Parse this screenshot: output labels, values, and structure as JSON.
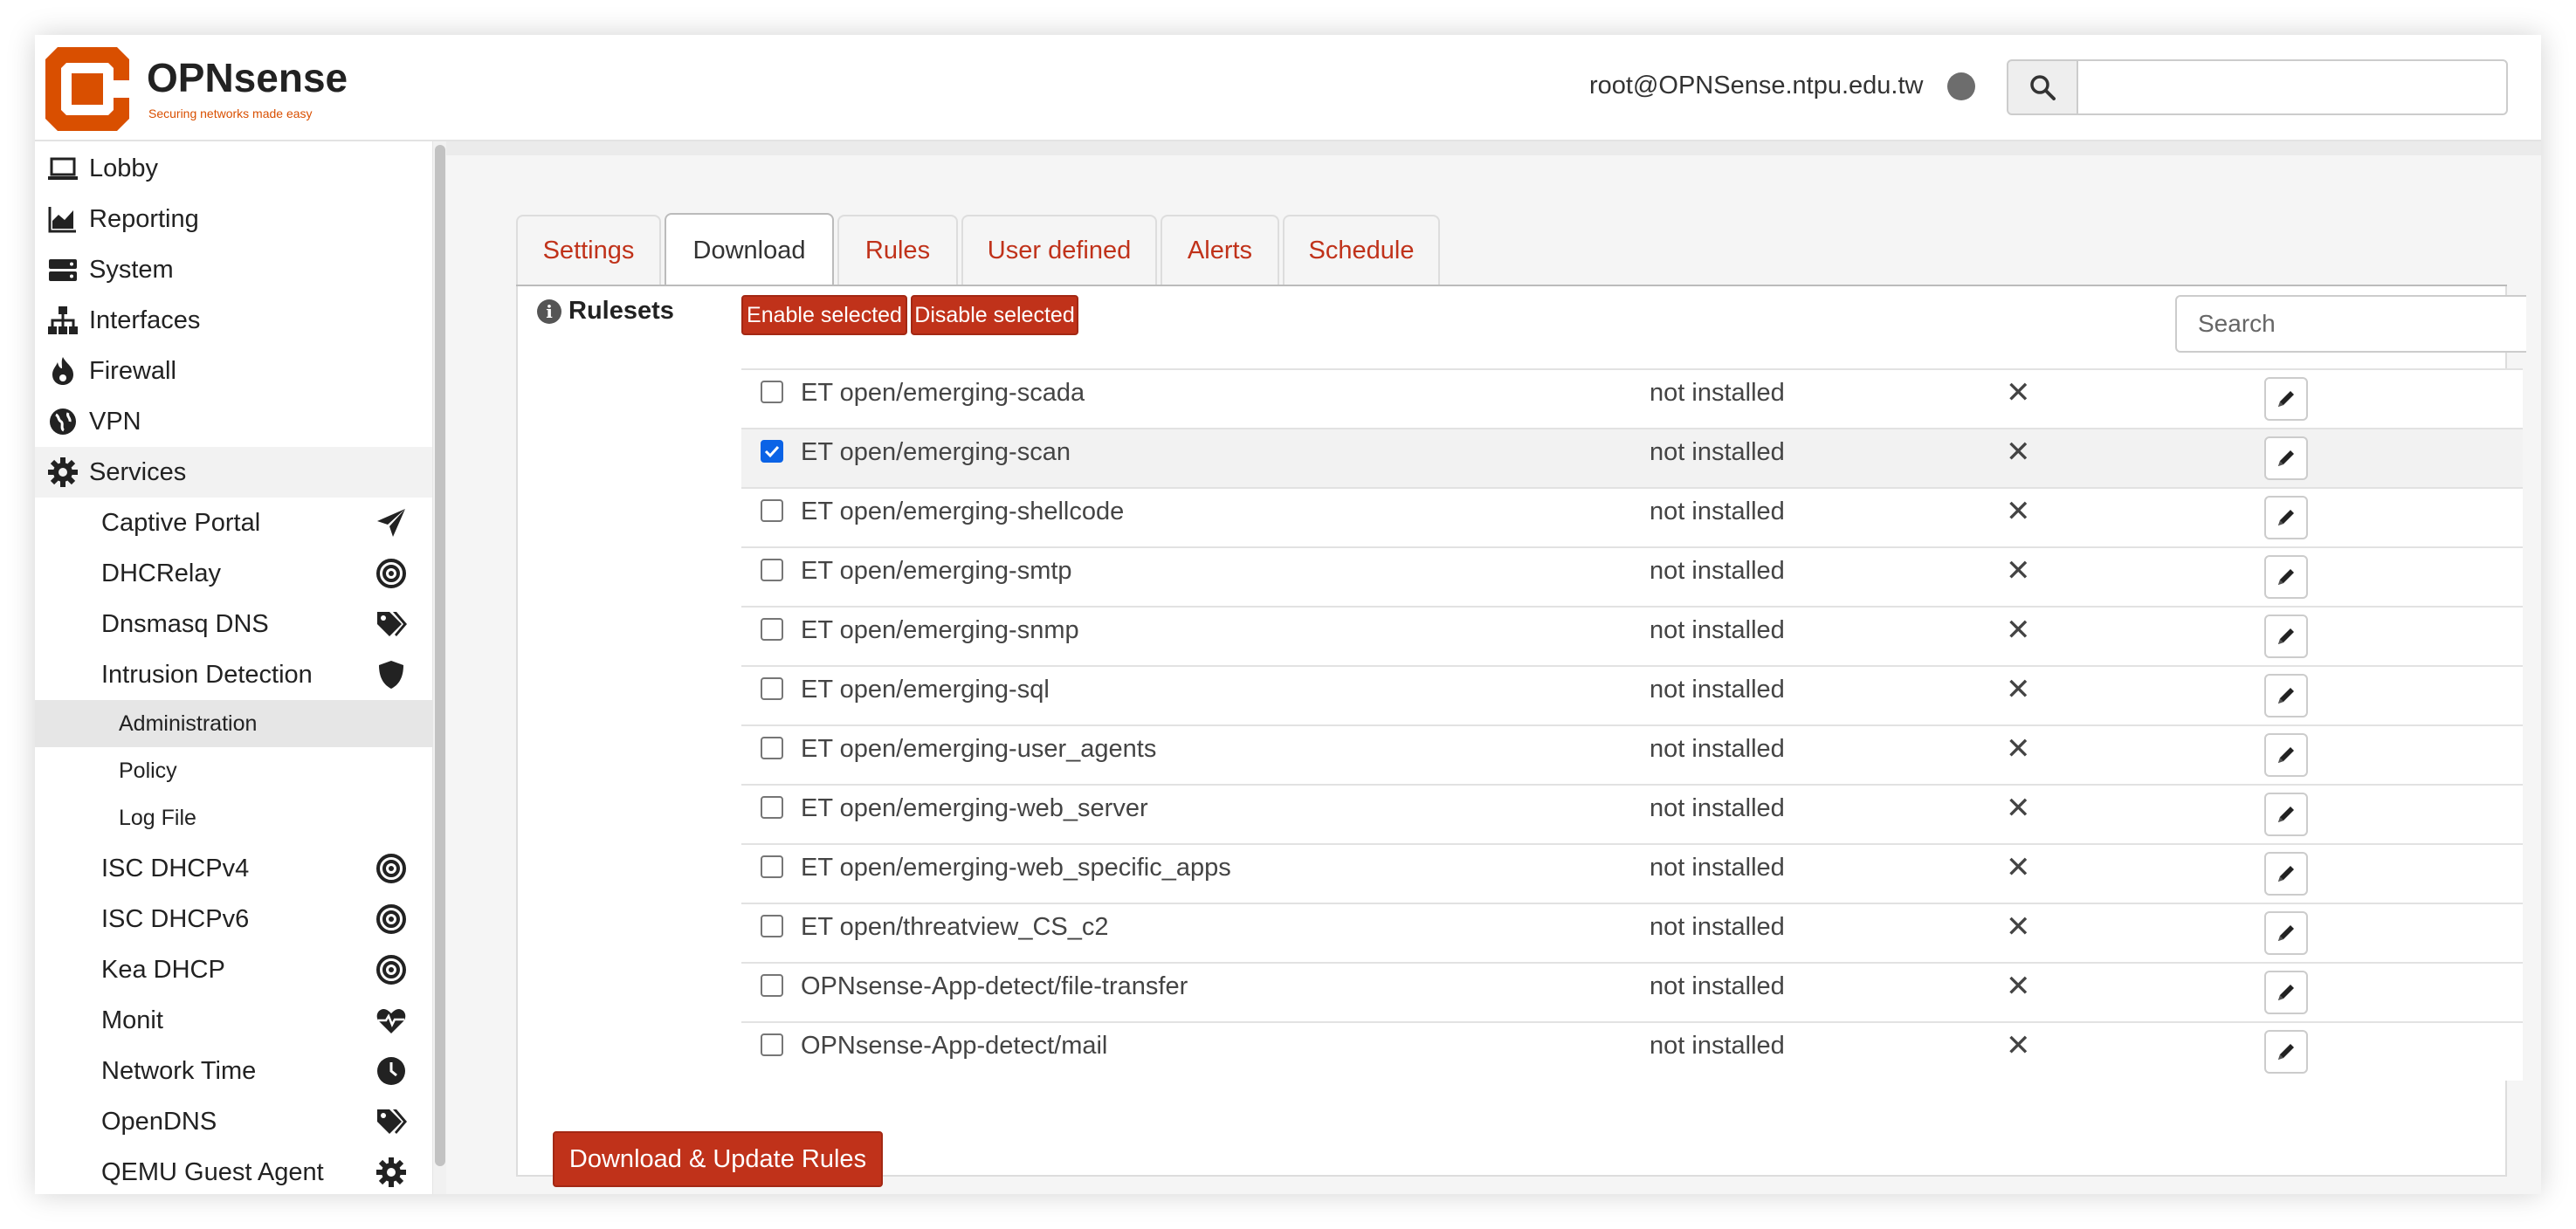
{
  "header": {
    "brand": "OPNsense",
    "tagline": "Securing networks made easy",
    "user": "root@OPNSense.ntpu.edu.tw",
    "search_placeholder": ""
  },
  "sidebar": {
    "items": [
      {
        "label": "Lobby",
        "icon": "laptop-icon"
      },
      {
        "label": "Reporting",
        "icon": "area-chart-icon"
      },
      {
        "label": "System",
        "icon": "server-icon"
      },
      {
        "label": "Interfaces",
        "icon": "sitemap-icon"
      },
      {
        "label": "Firewall",
        "icon": "fire-icon"
      },
      {
        "label": "VPN",
        "icon": "globe-icon"
      },
      {
        "label": "Services",
        "icon": "gear-icon"
      }
    ],
    "services": [
      {
        "label": "Captive Portal",
        "icon": "paper-plane-icon"
      },
      {
        "label": "DHCRelay",
        "icon": "bullseye-icon"
      },
      {
        "label": "Dnsmasq DNS",
        "icon": "tags-icon"
      },
      {
        "label": "Intrusion Detection",
        "icon": "shield-icon"
      },
      {
        "label": "ISC DHCPv4",
        "icon": "bullseye-icon"
      },
      {
        "label": "ISC DHCPv6",
        "icon": "bullseye-icon"
      },
      {
        "label": "Kea DHCP",
        "icon": "bullseye-icon"
      },
      {
        "label": "Monit",
        "icon": "heartbeat-icon"
      },
      {
        "label": "Network Time",
        "icon": "clock-icon"
      },
      {
        "label": "OpenDNS",
        "icon": "tags-icon"
      },
      {
        "label": "QEMU Guest Agent",
        "icon": "gear-icon"
      }
    ],
    "ids_sub": [
      "Administration",
      "Policy",
      "Log File"
    ]
  },
  "tabs": [
    "Settings",
    "Download",
    "Rules",
    "User defined",
    "Alerts",
    "Schedule"
  ],
  "active_tab": "Download",
  "rulesets": {
    "label": "Rulesets",
    "enable_label": "Enable selected",
    "disable_label": "Disable selected",
    "search_placeholder": "Search",
    "rows": [
      {
        "name": "ET open/emerging-scada",
        "state": "not installed",
        "checked": false
      },
      {
        "name": "ET open/emerging-scan",
        "state": "not installed",
        "checked": true
      },
      {
        "name": "ET open/emerging-shellcode",
        "state": "not installed",
        "checked": false
      },
      {
        "name": "ET open/emerging-smtp",
        "state": "not installed",
        "checked": false
      },
      {
        "name": "ET open/emerging-snmp",
        "state": "not installed",
        "checked": false
      },
      {
        "name": "ET open/emerging-sql",
        "state": "not installed",
        "checked": false
      },
      {
        "name": "ET open/emerging-user_agents",
        "state": "not installed",
        "checked": false
      },
      {
        "name": "ET open/emerging-web_server",
        "state": "not installed",
        "checked": false
      },
      {
        "name": "ET open/emerging-web_specific_apps",
        "state": "not installed",
        "checked": false
      },
      {
        "name": "ET open/threatview_CS_c2",
        "state": "not installed",
        "checked": false
      },
      {
        "name": "OPNsense-App-detect/file-transfer",
        "state": "not installed",
        "checked": false
      },
      {
        "name": "OPNsense-App-detect/mail",
        "state": "not installed",
        "checked": false
      }
    ]
  },
  "download_button": "Download & Update Rules",
  "colors": {
    "accent": "#c0321a",
    "checkbox": "#0b63e6"
  }
}
